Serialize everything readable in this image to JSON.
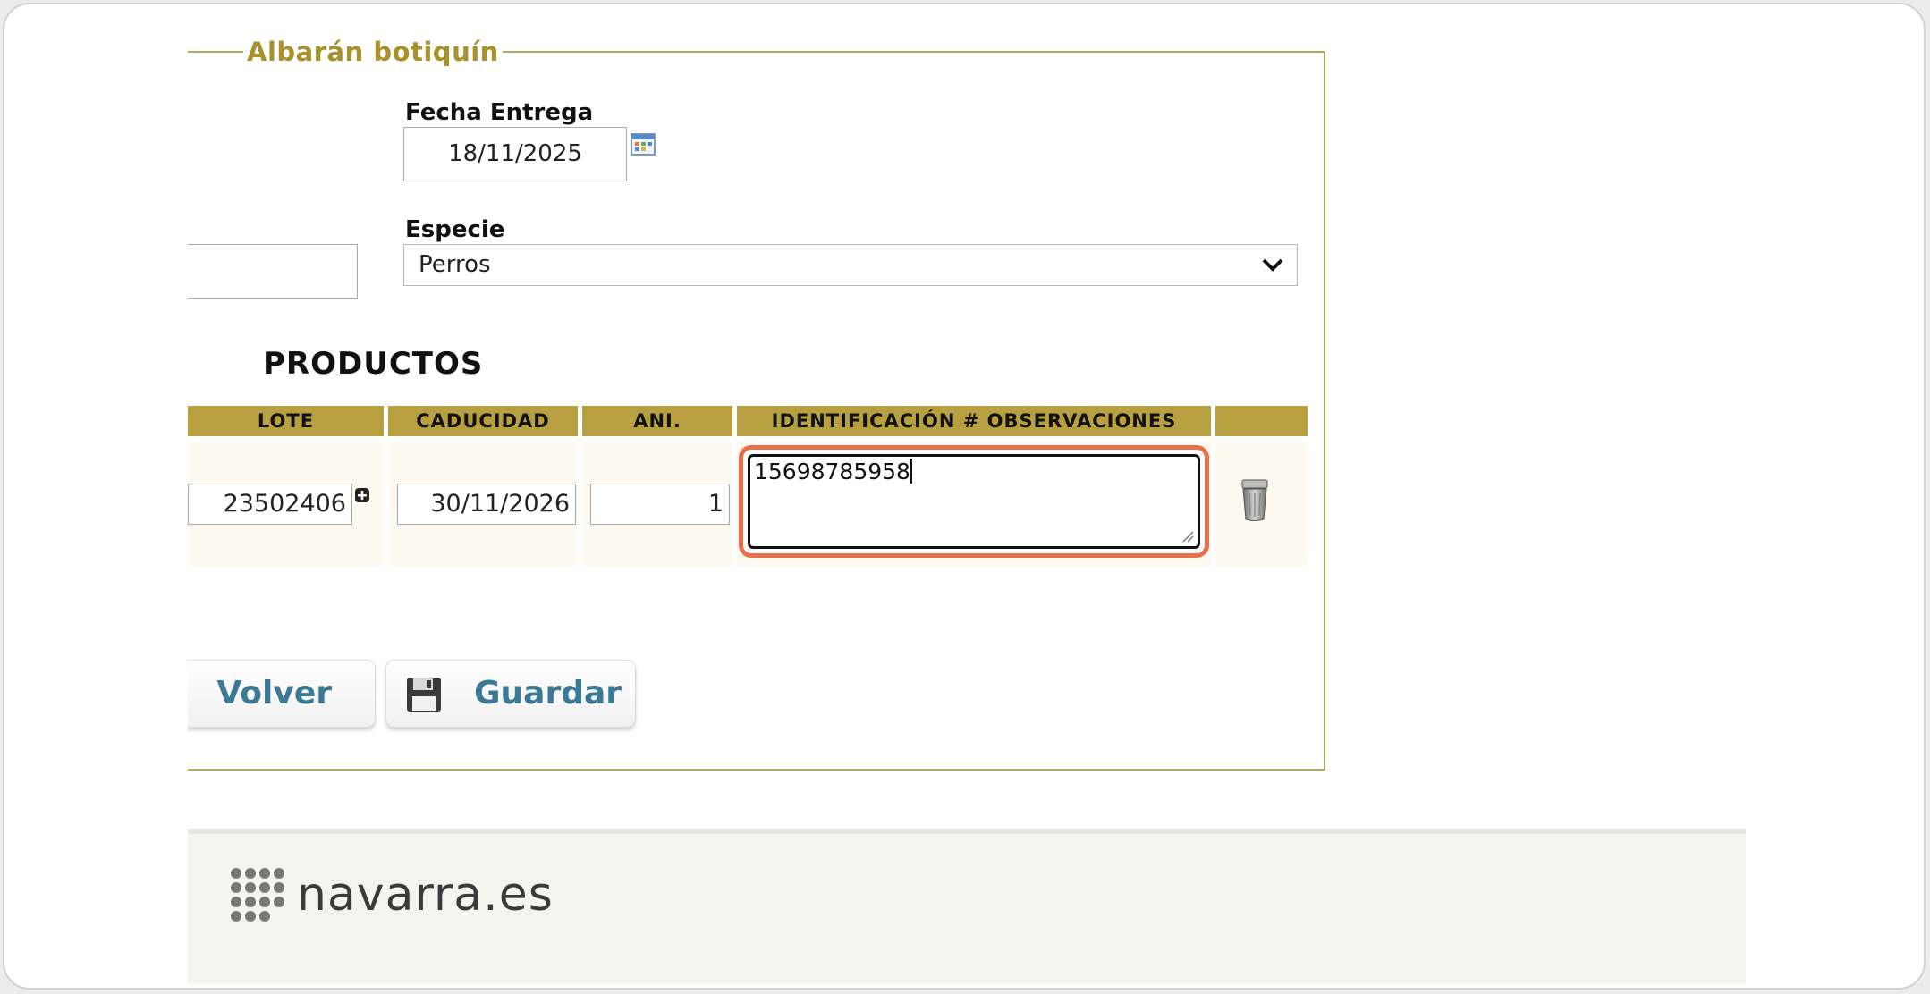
{
  "form": {
    "legend": "Albarán botiquín",
    "fecha_label": "Fecha Entrega",
    "fecha_value": "18/11/2025",
    "especie_label": "Especie",
    "especie_value": "Perros"
  },
  "productos": {
    "title": "PRODUCTOS",
    "columns": [
      "LOTE",
      "CADUCIDAD",
      "ANI.",
      "IDENTIFICACIÓN # OBSERVACIONES"
    ],
    "row": {
      "lote": "23502406",
      "caducidad": "30/11/2026",
      "ani": "1",
      "observaciones": "15698785958"
    }
  },
  "buttons": {
    "volver": "Volver",
    "guardar": "Guardar"
  },
  "footer": {
    "brand": "navarra.es"
  },
  "colors": {
    "gold": "#b8a040",
    "legend": "#a9912c",
    "button_text": "#3b7a94",
    "highlight": "#e8704a"
  }
}
